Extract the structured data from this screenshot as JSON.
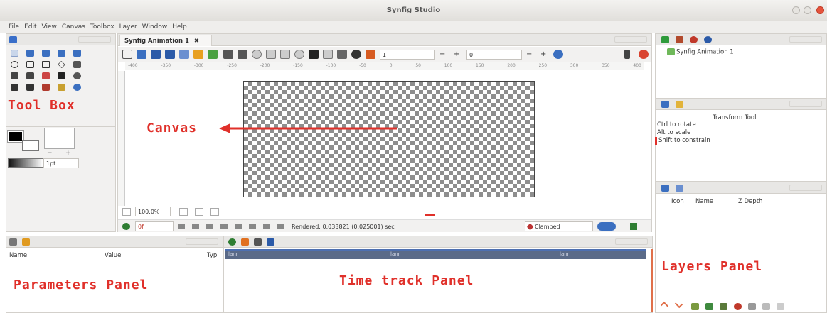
{
  "window": {
    "title": "Synfig Studio"
  },
  "menu": [
    "File",
    "Edit",
    "View",
    "Canvas",
    "Toolbox",
    "Layer",
    "Window",
    "Help"
  ],
  "document_tab": {
    "label": "Synfig Animation 1",
    "close": "✖"
  },
  "toolbar": {
    "frame_value": "1",
    "minus": "−",
    "plus": "+",
    "frame_value_2": "0"
  },
  "ruler_ticks": [
    "-400",
    "-350",
    "-300",
    "-250",
    "-200",
    "-150",
    "-100",
    "-50",
    "0",
    "50",
    "100",
    "150",
    "200",
    "250",
    "300",
    "350",
    "400"
  ],
  "toolbox": {
    "annotation": "Tool Box",
    "width_value": "1pt",
    "minus": "−",
    "plus": "+"
  },
  "canvas": {
    "annotation": "Canvas"
  },
  "statusbar": {
    "zoom": "100.0%",
    "frame_field": "0f",
    "rendered": "Rendered: 0.033821 (0.025001) sec",
    "interpolation": "Clamped"
  },
  "canvas_browser": {
    "item": "Synfig Animation 1"
  },
  "tool_options": {
    "title": "Transform Tool",
    "lines": [
      "Ctrl to rotate",
      "Alt to scale",
      "Shift to constrain"
    ]
  },
  "layers": {
    "col_icon": "Icon",
    "col_name": "Name",
    "col_zdepth": "Z Depth",
    "annotation": "Layers  Panel"
  },
  "params": {
    "col_name": "Name",
    "col_value": "Value",
    "col_type": "Typ",
    "annotation": "Parameters  Panel"
  },
  "timetrack": {
    "annotation": "Time  track  Panel",
    "labels": [
      "lanr",
      "lanr",
      "lanr"
    ]
  },
  "colors": {
    "annotation_red": "#e0302a",
    "timebar_blue": "#4d6fb0"
  }
}
